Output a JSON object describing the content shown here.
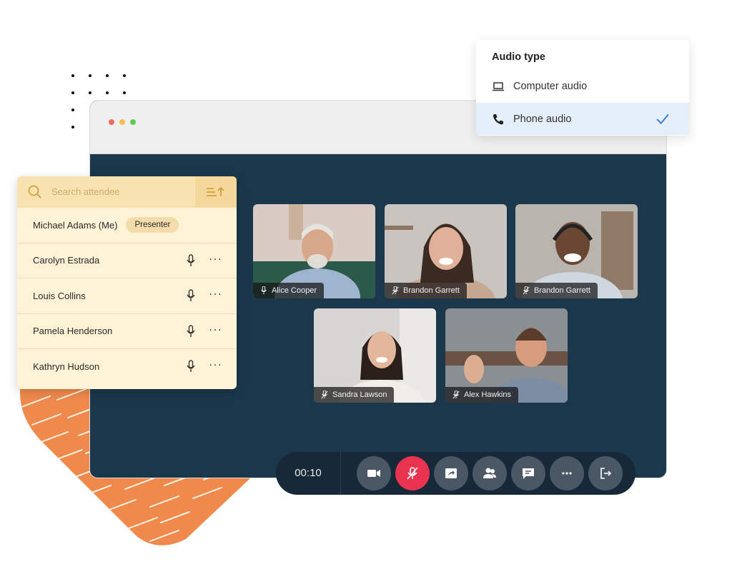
{
  "window": {
    "traffic_lights": [
      {
        "name": "close",
        "color": "#ee6b63"
      },
      {
        "name": "minimize",
        "color": "#f4bd4f"
      },
      {
        "name": "maximize",
        "color": "#5fcb54"
      }
    ],
    "stage_color": "#1b374b"
  },
  "audio_menu": {
    "title": "Audio type",
    "options": [
      {
        "label": "Computer audio",
        "icon": "laptop-icon",
        "selected": false
      },
      {
        "label": "Phone audio",
        "icon": "phone-icon",
        "selected": true
      }
    ],
    "check_color": "#3b82d6"
  },
  "attendees": {
    "search_placeholder": "Search attendee",
    "sort_icon": "sort-ascending-icon",
    "list": [
      {
        "name": "Michael Adams (Me)",
        "badge": "Presenter"
      },
      {
        "name": "Carolyn Estrada",
        "mic": true,
        "more": "···"
      },
      {
        "name": "Louis Collins",
        "mic": true,
        "more": "···"
      },
      {
        "name": "Pamela Henderson",
        "mic": true,
        "more": "···"
      },
      {
        "name": "Kathryn Hudson",
        "mic": true,
        "more": "···"
      }
    ]
  },
  "video_tiles": [
    {
      "name": "Alice Cooper",
      "muted": false
    },
    {
      "name": "Brandon Garrett",
      "muted": true
    },
    {
      "name": "Brandon Garrett",
      "muted": true
    },
    {
      "name": "Sandra Lawson",
      "muted": true
    },
    {
      "name": "Alex Hawkins",
      "muted": true
    }
  ],
  "controls": {
    "timer": "00:10",
    "buttons": [
      {
        "name": "video",
        "icon": "video-camera-icon"
      },
      {
        "name": "mute",
        "icon": "mic-off-icon",
        "active_color": "#e8344e"
      },
      {
        "name": "share-screen",
        "icon": "share-screen-icon"
      },
      {
        "name": "participants",
        "icon": "participants-icon"
      },
      {
        "name": "chat",
        "icon": "chat-icon"
      },
      {
        "name": "more",
        "icon": "more-icon"
      },
      {
        "name": "leave",
        "icon": "leave-icon"
      }
    ]
  },
  "colors": {
    "accent_orange": "#ef8a4c",
    "panel_bg": "#fff2d6",
    "panel_header": "#f8e2b0"
  }
}
